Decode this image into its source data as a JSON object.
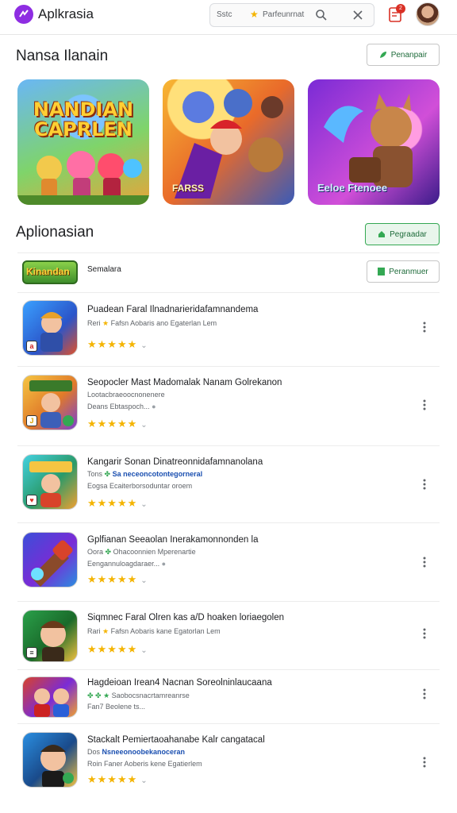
{
  "header": {
    "title": "Aplkrasia",
    "search_placeholder": "Sstc",
    "search_filter": "Parfeunrnat",
    "notification_count": "2"
  },
  "featured": {
    "title": "Nansa Ilanain",
    "button_label": "Penanpair",
    "cards": [
      {
        "art_title": "NANDIAN CAPRLEN",
        "caption": ""
      },
      {
        "art_title": "",
        "caption": "FARSS"
      },
      {
        "art_title": "",
        "caption": "Eeloe Ftenoee"
      }
    ]
  },
  "apps": {
    "title": "Aplionasian",
    "button_label": "Pegraadar",
    "banner_label": "Semalara",
    "banner_button": "Peranmuer",
    "items": [
      {
        "name": "Puadean Faral Ilnadnarieridafamnandema",
        "sub1_a": "Reri ",
        "sub1_b": "Fafsn Aobaris ano Egaterlan Lem",
        "sub2": "",
        "rating": "★★★★★"
      },
      {
        "name": "Seopocler Mast Madomalak Nanam Golrekanon",
        "sub1_a": "",
        "sub1_b": "Lootacbraeoocnonenere",
        "sub2": "Deans Ebtaspoch...",
        "rating": "★★★★★"
      },
      {
        "name": "Kangarir Sonan Dinatreonnidafamnanolana",
        "sub1_a": "Tons ",
        "sub1_b": "Sa neceoncotontegorneral",
        "sub2": "Eogsa Ecaiterborsoduntar oroem",
        "rating": "★★★★★"
      },
      {
        "name": "Gplfianan Seeaolan Inerakamonnonden la",
        "sub1_a": "Oora ",
        "sub1_b": "Ohacoonnien Mperenartie",
        "sub2": "Eengannuloagdaraer...",
        "rating": "★★★★★"
      },
      {
        "name": "Siqmnec Faral Olren kas a/D hoaken loriaegolen",
        "sub1_a": "Rari ",
        "sub1_b": "Fafsn Aobaris kane Egatorlan Lem",
        "sub2": "",
        "rating": "★★★★★"
      },
      {
        "name": "Hagdeioan Irean4 Nacnan Soreolninlaucaana",
        "sub1_a": "",
        "sub1_b": "Saobocsnacrtamreanrse",
        "sub2": "Fan7 Beolene ts...",
        "rating": ""
      },
      {
        "name": "Stackalt Pemiertaoahanabe Kalr cangatacal",
        "sub1_a": "Dos ",
        "sub1_b": "Nsneeonoobekanoceran",
        "sub2": "Roin Faner Aoberis kene Egatierlem",
        "rating": "★★★★★"
      }
    ]
  },
  "colors": {
    "accent": "#8e2de2",
    "green": "#34a853",
    "star": "#f4b400",
    "badge": "#d93025"
  }
}
